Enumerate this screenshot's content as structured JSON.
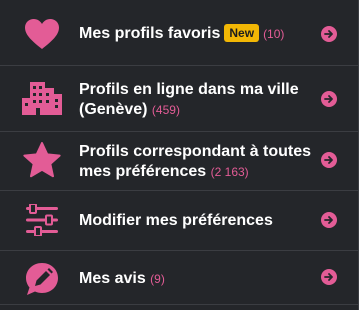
{
  "colors": {
    "background": "#24262a",
    "accent": "#e35c96",
    "badge": "#f2b705",
    "divider": "#3b3d42"
  },
  "menu": {
    "items": [
      {
        "icon": "heart-icon",
        "label": "Mes profils favoris",
        "badge": "New",
        "count": "(10)"
      },
      {
        "icon": "city-buildings-icon",
        "label": "Profils en ligne dans ma ville (Genève)",
        "count": "(459)"
      },
      {
        "icon": "star-icon",
        "label": "Profils correspondant à toutes mes préférences",
        "count": "(2 163)"
      },
      {
        "icon": "sliders-icon",
        "label": "Modifier mes préférences"
      },
      {
        "icon": "pencil-speech-bubble-icon",
        "label": "Mes avis",
        "count": "(9)"
      }
    ]
  }
}
